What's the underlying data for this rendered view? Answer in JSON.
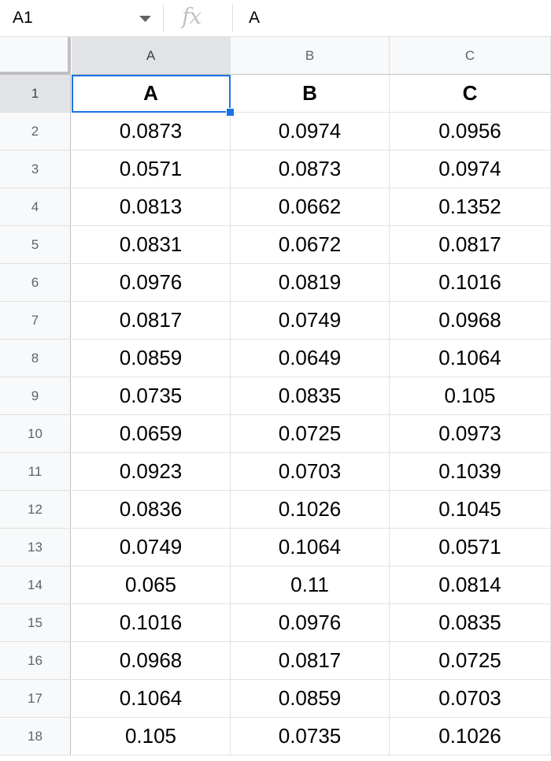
{
  "formula_bar": {
    "cell_reference": "A1",
    "fx_label": "fx",
    "content": "A"
  },
  "columns": [
    "A",
    "B",
    "C"
  ],
  "selected_cell": "A1",
  "accent_color": "#1a73e8",
  "rows": [
    {
      "num": "1",
      "cells": [
        "A",
        "B",
        "C"
      ]
    },
    {
      "num": "2",
      "cells": [
        "0.0873",
        "0.0974",
        "0.0956"
      ]
    },
    {
      "num": "3",
      "cells": [
        "0.0571",
        "0.0873",
        "0.0974"
      ]
    },
    {
      "num": "4",
      "cells": [
        "0.0813",
        "0.0662",
        "0.1352"
      ]
    },
    {
      "num": "5",
      "cells": [
        "0.0831",
        "0.0672",
        "0.0817"
      ]
    },
    {
      "num": "6",
      "cells": [
        "0.0976",
        "0.0819",
        "0.1016"
      ]
    },
    {
      "num": "7",
      "cells": [
        "0.0817",
        "0.0749",
        "0.0968"
      ]
    },
    {
      "num": "8",
      "cells": [
        "0.0859",
        "0.0649",
        "0.1064"
      ]
    },
    {
      "num": "9",
      "cells": [
        "0.0735",
        "0.0835",
        "0.105"
      ]
    },
    {
      "num": "10",
      "cells": [
        "0.0659",
        "0.0725",
        "0.0973"
      ]
    },
    {
      "num": "11",
      "cells": [
        "0.0923",
        "0.0703",
        "0.1039"
      ]
    },
    {
      "num": "12",
      "cells": [
        "0.0836",
        "0.1026",
        "0.1045"
      ]
    },
    {
      "num": "13",
      "cells": [
        "0.0749",
        "0.1064",
        "0.0571"
      ]
    },
    {
      "num": "14",
      "cells": [
        "0.065",
        "0.11",
        "0.0814"
      ]
    },
    {
      "num": "15",
      "cells": [
        "0.1016",
        "0.0976",
        "0.0835"
      ]
    },
    {
      "num": "16",
      "cells": [
        "0.0968",
        "0.0817",
        "0.0725"
      ]
    },
    {
      "num": "17",
      "cells": [
        "0.1064",
        "0.0859",
        "0.0703"
      ]
    },
    {
      "num": "18",
      "cells": [
        "0.105",
        "0.0735",
        "0.1026"
      ]
    }
  ]
}
